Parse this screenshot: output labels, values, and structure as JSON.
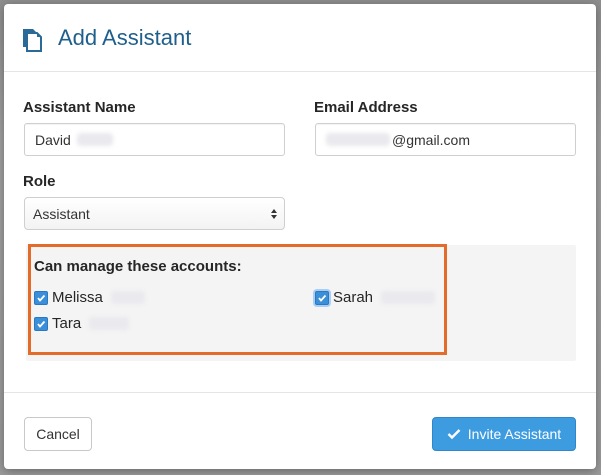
{
  "modal": {
    "title": "Add Assistant",
    "icon": "document-copy-icon"
  },
  "form": {
    "name": {
      "label": "Assistant Name",
      "value": "David"
    },
    "email": {
      "label": "Email Address",
      "value": "@gmail.com"
    },
    "role": {
      "label": "Role",
      "selected": "Assistant"
    }
  },
  "accounts": {
    "title": "Can manage these accounts:",
    "items": [
      {
        "name": "Melissa",
        "checked": true
      },
      {
        "name": "Sarah",
        "checked": true
      },
      {
        "name": "Tara",
        "checked": true
      }
    ]
  },
  "footer": {
    "cancel_label": "Cancel",
    "invite_label": "Invite Assistant"
  },
  "colors": {
    "title": "#1f5f8b",
    "primary_button": "#3d9be0",
    "highlight": "#e36c2a",
    "checkbox": "#3b8fd9"
  }
}
